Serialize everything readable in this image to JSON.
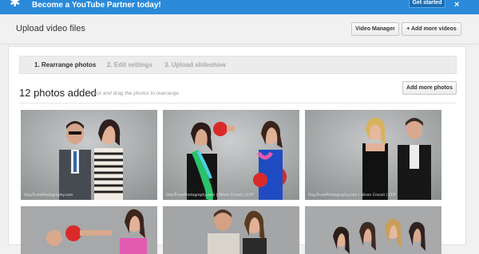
{
  "banner": {
    "message": "Become a YouTube Partner today!",
    "cta_label": "Get started",
    "close_label": "×",
    "accent": "#2a8ad9"
  },
  "header": {
    "title": "Upload video files",
    "video_manager_label": "Video Manager",
    "add_more_videos_label": "+ Add more videos"
  },
  "steps": [
    {
      "label": "1. Rearrange photos",
      "state": "active"
    },
    {
      "label": "2. Edit settings",
      "state": "inactive"
    },
    {
      "label": "3. Upload slideshow",
      "state": "inactive"
    }
  ],
  "photos_section": {
    "count_label": "12 photos added",
    "hint": "Click and drag the photos to rearrange",
    "add_more_photos_label": "Add more photos"
  },
  "photos": [
    {
      "watermark": "StayTrueePhotography.com"
    },
    {
      "watermark": "StayTrueePhotography.com | Alison Crossit | CCP"
    },
    {
      "watermark": "StayTrueePhotography.com | Alison Crossit | CCP"
    },
    {
      "watermark": ""
    },
    {
      "watermark": ""
    },
    {
      "watermark": ""
    }
  ]
}
